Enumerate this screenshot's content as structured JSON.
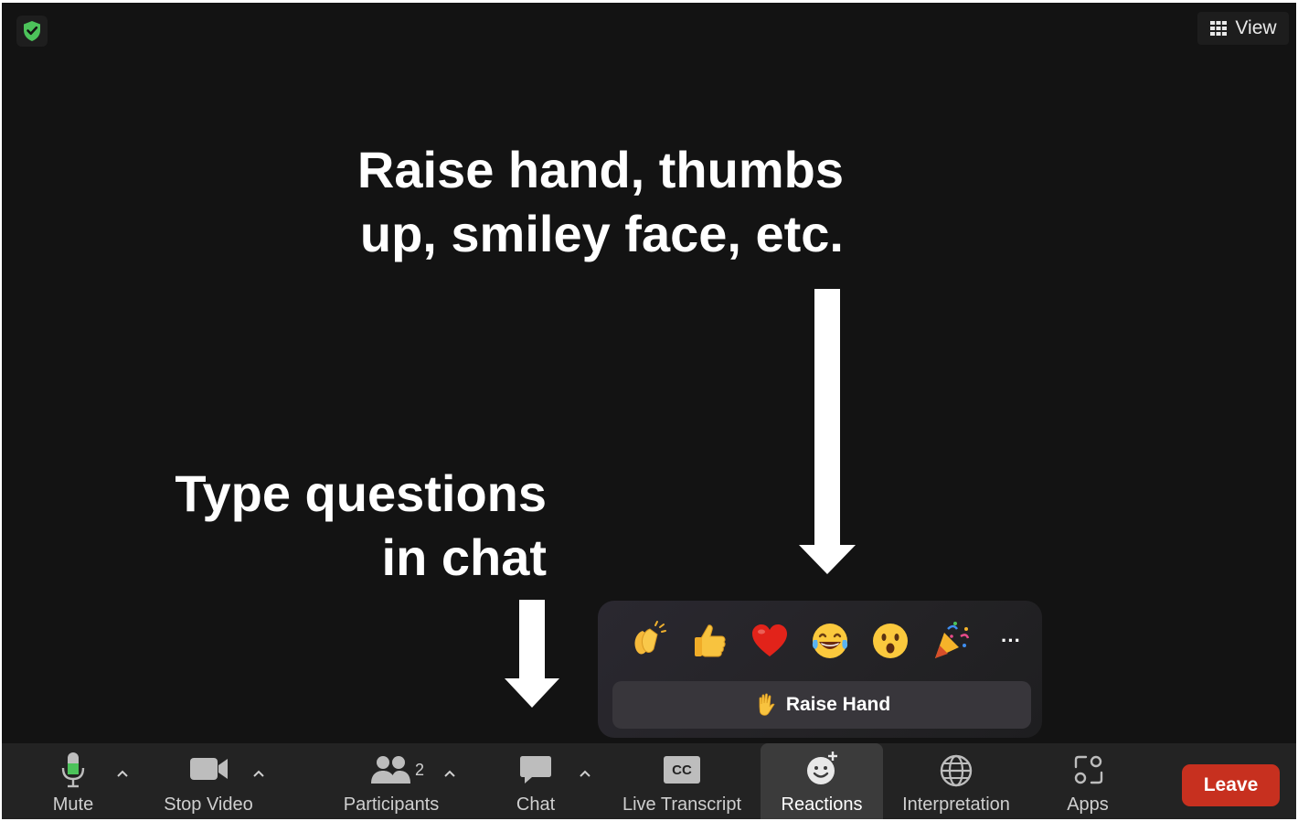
{
  "header": {
    "view_label": "View"
  },
  "annotations": {
    "reactions_line1": "Raise hand, thumbs",
    "reactions_line2": "up, smiley face, etc.",
    "chat_line1": "Type questions",
    "chat_line2": "in chat"
  },
  "reactions_popover": {
    "emojis": [
      "clapping-hands",
      "thumbs-up",
      "heart",
      "tears-of-joy",
      "open-mouth",
      "party-popper"
    ],
    "more_label": "···",
    "raise_hand_label": "Raise Hand"
  },
  "toolbar": {
    "mute_label": "Mute",
    "stop_video_label": "Stop Video",
    "participants_label": "Participants",
    "participants_count": "2",
    "chat_label": "Chat",
    "live_transcript_label": "Live Transcript",
    "cc_text": "CC",
    "reactions_label": "Reactions",
    "interpretation_label": "Interpretation",
    "apps_label": "Apps",
    "leave_label": "Leave"
  },
  "colors": {
    "background": "#131313",
    "toolbar": "#232323",
    "leave": "#c7301f",
    "shield": "#4cc35a",
    "mic_active": "#4cc35a"
  }
}
